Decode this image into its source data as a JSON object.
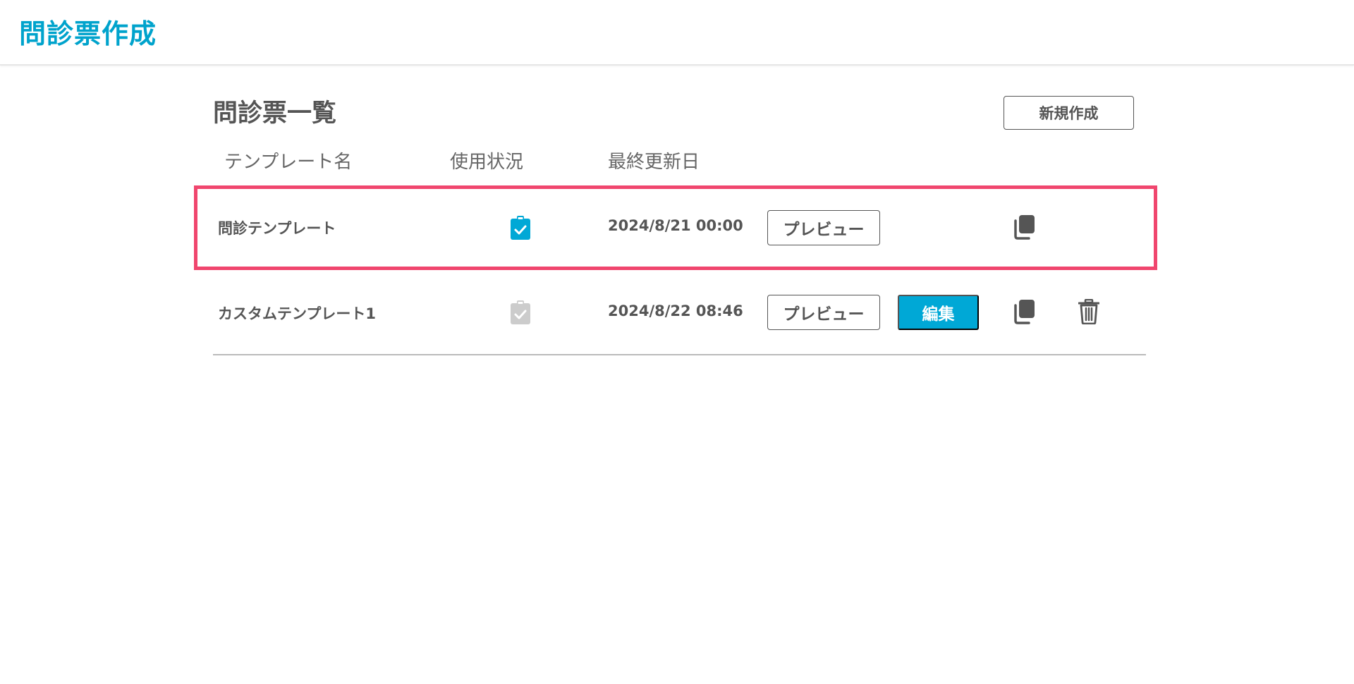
{
  "app": {
    "title": "問診票作成"
  },
  "page": {
    "title": "問診票一覧",
    "new_button_label": "新規作成"
  },
  "table": {
    "columns": [
      "テンプレート名",
      "使用状況",
      "最終更新日"
    ],
    "rows": [
      {
        "name": "問診テンプレート",
        "in_use": true,
        "updated": "2024/8/21 00:00",
        "preview_label": "プレビュー",
        "highlighted": true
      },
      {
        "name": "カスタムテンプレート1",
        "in_use": false,
        "updated": "2024/8/22 08:46",
        "preview_label": "プレビュー",
        "edit_label": "編集"
      }
    ]
  },
  "colors": {
    "accent": "#00a8d6",
    "highlight": "#f0466e",
    "inactive_icon": "#cccccc",
    "text": "#555555"
  },
  "icons": {
    "status_active": "clipboard-check-icon",
    "status_inactive": "clipboard-check-icon",
    "copy": "copy-icon",
    "delete": "trash-icon"
  }
}
